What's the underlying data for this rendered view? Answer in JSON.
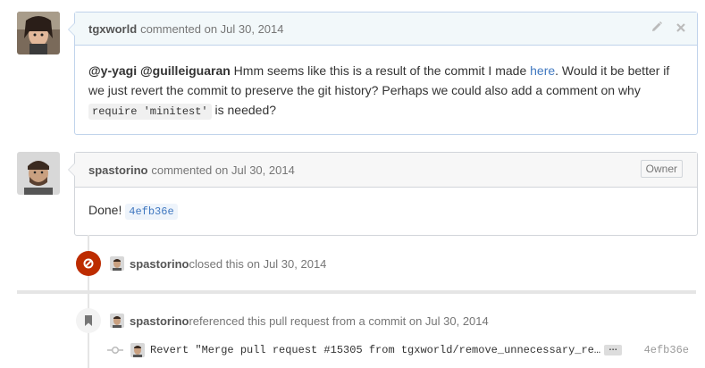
{
  "comments": [
    {
      "author": "tgxworld",
      "meta": "commented on Jul 30, 2014",
      "mention1": "@y-yagi",
      "mention2": "@guilleiguaran",
      "text1": " Hmm seems like this is a result of the commit I made ",
      "link": "here",
      "text2": ". Would it be better if we just revert the commit to preserve the git history? Perhaps we could also add a comment on why ",
      "code": "require 'minitest'",
      "text3": " is needed?",
      "edit_icon": "pencil-icon",
      "close_icon": "close-icon"
    },
    {
      "author": "spastorino",
      "meta": "commented on Jul 30, 2014",
      "badge": "Owner",
      "text": "Done! ",
      "sha": "4efb36e"
    }
  ],
  "events": [
    {
      "actor": "spastorino",
      "text": " closed this on Jul 30, 2014",
      "icon": "closed-circle-icon",
      "color": "#bd2c00"
    },
    {
      "actor": "spastorino",
      "text": " referenced this pull request from a commit on Jul 30, 2014",
      "icon": "bookmark-icon",
      "commit_message": "Revert \"Merge pull request #15305 from tgxworld/remove_unnecessary_re…",
      "commit_ellipsis": "…",
      "commit_sha": "4efb36e"
    }
  ]
}
